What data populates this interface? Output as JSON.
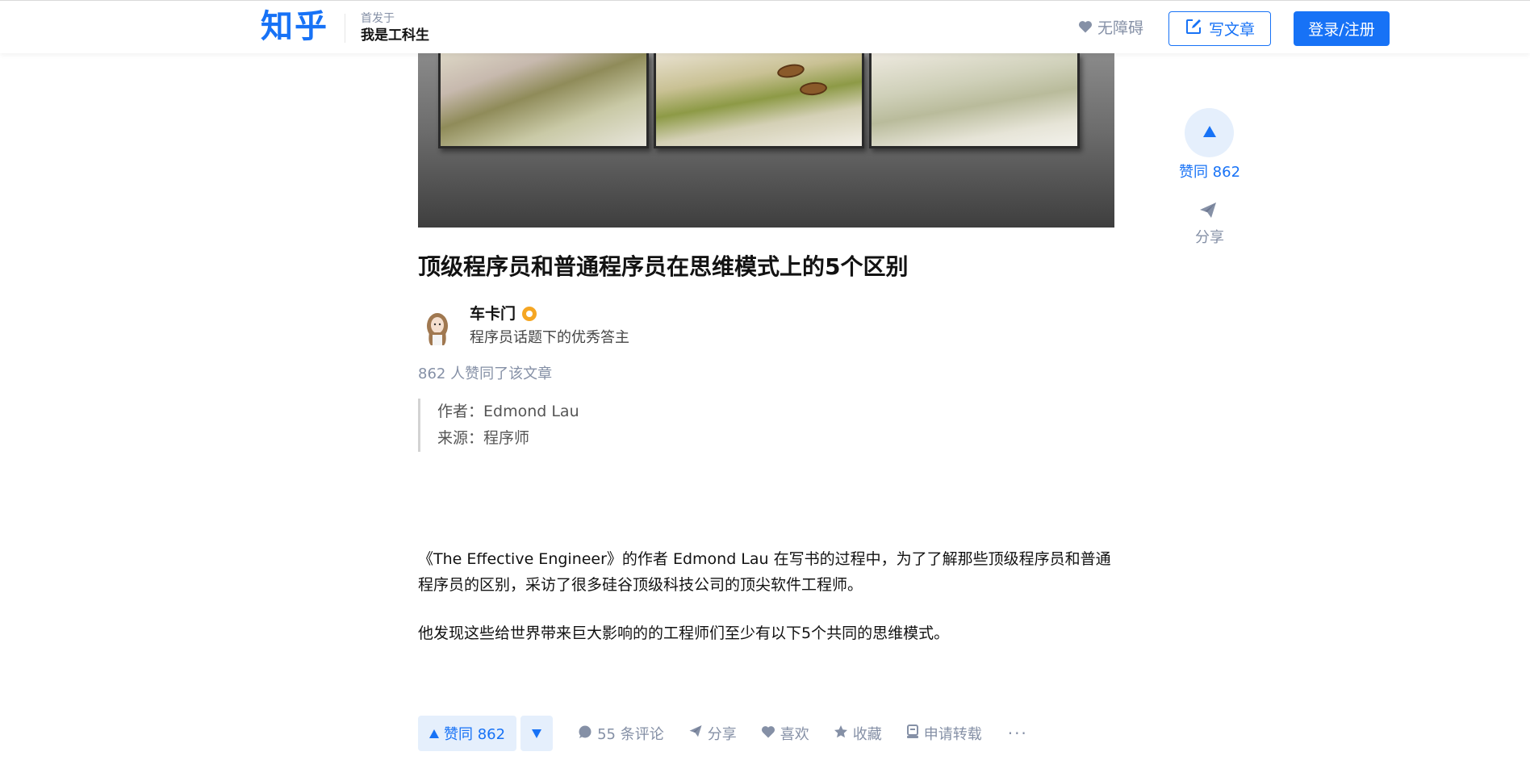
{
  "header": {
    "logo": "知乎",
    "published_in_label": "首发于",
    "column_name": "我是工科生",
    "accessibility_label": "无障碍",
    "write_article_label": "写文章",
    "login_label": "登录/注册"
  },
  "article": {
    "title": "顶级程序员和普通程序员在思维模式上的5个区别",
    "author": {
      "name": "车卡门",
      "description": "程序员话题下的优秀答主"
    },
    "vote_summary": "862 人赞同了该文章",
    "quote_lines": [
      "作者：Edmond Lau",
      "来源：程序师"
    ],
    "paragraphs": [
      "《The Effective Engineer》的作者 Edmond Lau 在写书的过程中，为了了解那些顶级程序员和普通程序员的区别，采访了很多硅谷顶级科技公司的顶尖软件工程师。",
      "他发现这些给世界带来巨大影响的的工程师们至少有以下5个共同的思维模式。"
    ]
  },
  "side_actions": {
    "vote_label": "赞同 862",
    "share_label": "分享"
  },
  "action_bar": {
    "vote_up_label": "赞同 862",
    "comments_label": "55 条评论",
    "share_label": "分享",
    "like_label": "喜欢",
    "favorite_label": "收藏",
    "reprint_label": "申请转载",
    "more_label": "···"
  },
  "colors": {
    "brand": "#1772f6",
    "muted": "#8590a6",
    "badge": "#f5a623"
  }
}
